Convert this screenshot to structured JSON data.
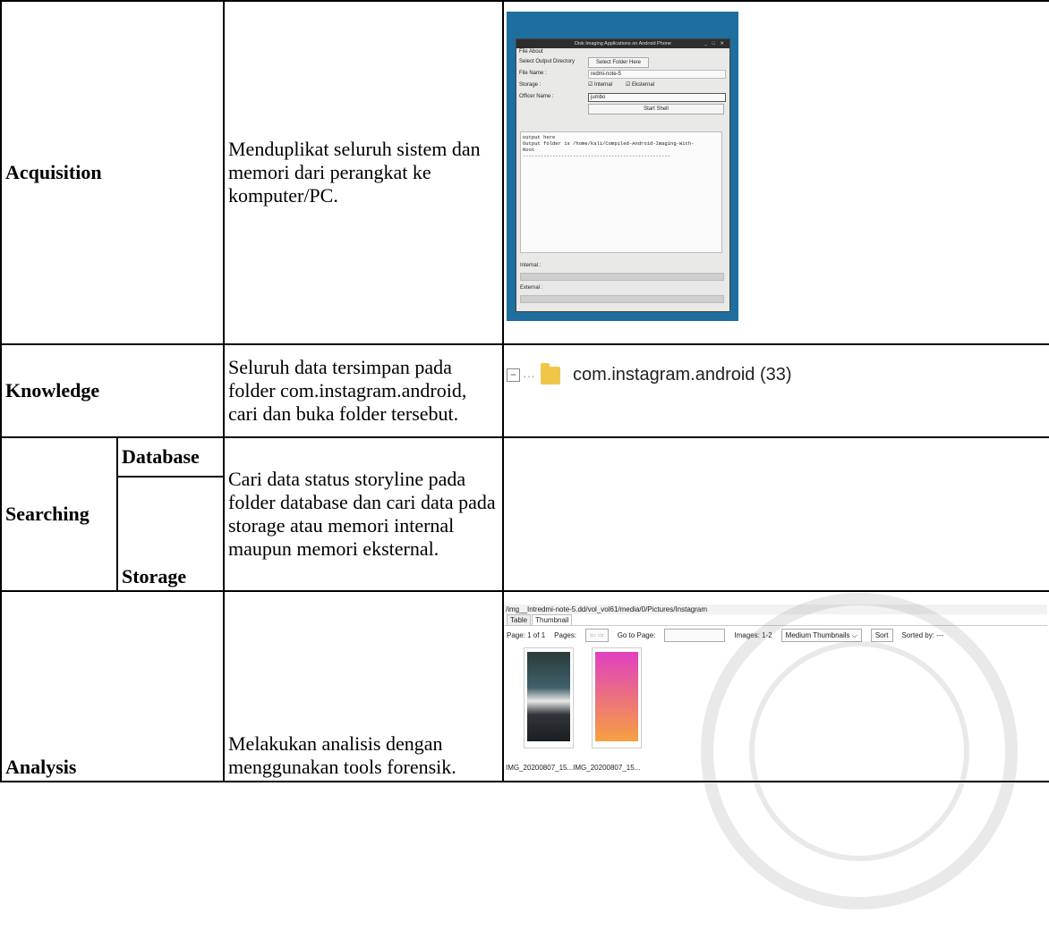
{
  "rows": {
    "acquisition": {
      "label": "Acquisition",
      "description": "Menduplikat seluruh sistem dan memori dari perangkat ke komputer/PC."
    },
    "knowledge": {
      "label": "Knowledge",
      "description": "Seluruh data tersimpan pada folder com.instagram.android, cari dan buka folder tersebut."
    },
    "searching": {
      "label": "Searching",
      "sub1": "Database",
      "sub2": "Storage",
      "description": "Cari data status storyline pada folder database dan cari data pada storage atau memori internal maupun memori eksternal."
    },
    "analysis": {
      "label": "Analysis",
      "description": "Melakukan analisis dengan menggunakan tools forensik."
    }
  },
  "acq_app": {
    "title": "Disk Imaging Applications on Android Phone",
    "controls": "_ □ ✕",
    "menu": "File  About",
    "select_dir_label": "Select Output Directory",
    "select_folder_button": "Select Folder Here",
    "file_name_label": "File Name :",
    "file_name_value": "redmi-note-5",
    "storage_label": "Storage :",
    "internal_opt": "☑ Internal",
    "external_opt": "☑ Eksternal",
    "officer_label": "Officer Name :",
    "officer_value": "jumbo",
    "start_button": "Start Shell",
    "output_text": "output here\nOutput folder is /home/kali/Compiled-Android-Imaging-With-\nRoot\n--------------------------------------------------",
    "internal_bar_label": "Internal :",
    "external_bar_label": "External :"
  },
  "tree_item": {
    "expander": "−",
    "dots": "···",
    "label": "com.instagram.android (33)"
  },
  "viewer": {
    "path": "/img__Intredmi-note-5.dd/vol_vol61/media/0/Pictures/Instagram",
    "tab_table": "Table",
    "tab_thumbnail": "Thumbnail",
    "page": "Page:  1 of 1",
    "pages": "Pages:",
    "nav": "⇦ ⇨",
    "goto": "Go to Page:",
    "images": "Images:  1-2",
    "size_select": "Medium Thumbnails ⌵",
    "sort_button": "Sort",
    "sorted_by": "Sorted by: ---",
    "captions": "IMG_20200807_15...IMG_20200807_15..."
  },
  "colors": {
    "photo_bg": "#1e6e9e",
    "folder": "#f0c64a",
    "thumb_gradient_top": "#e040c0",
    "thumb_gradient_bottom": "#f7a040"
  }
}
